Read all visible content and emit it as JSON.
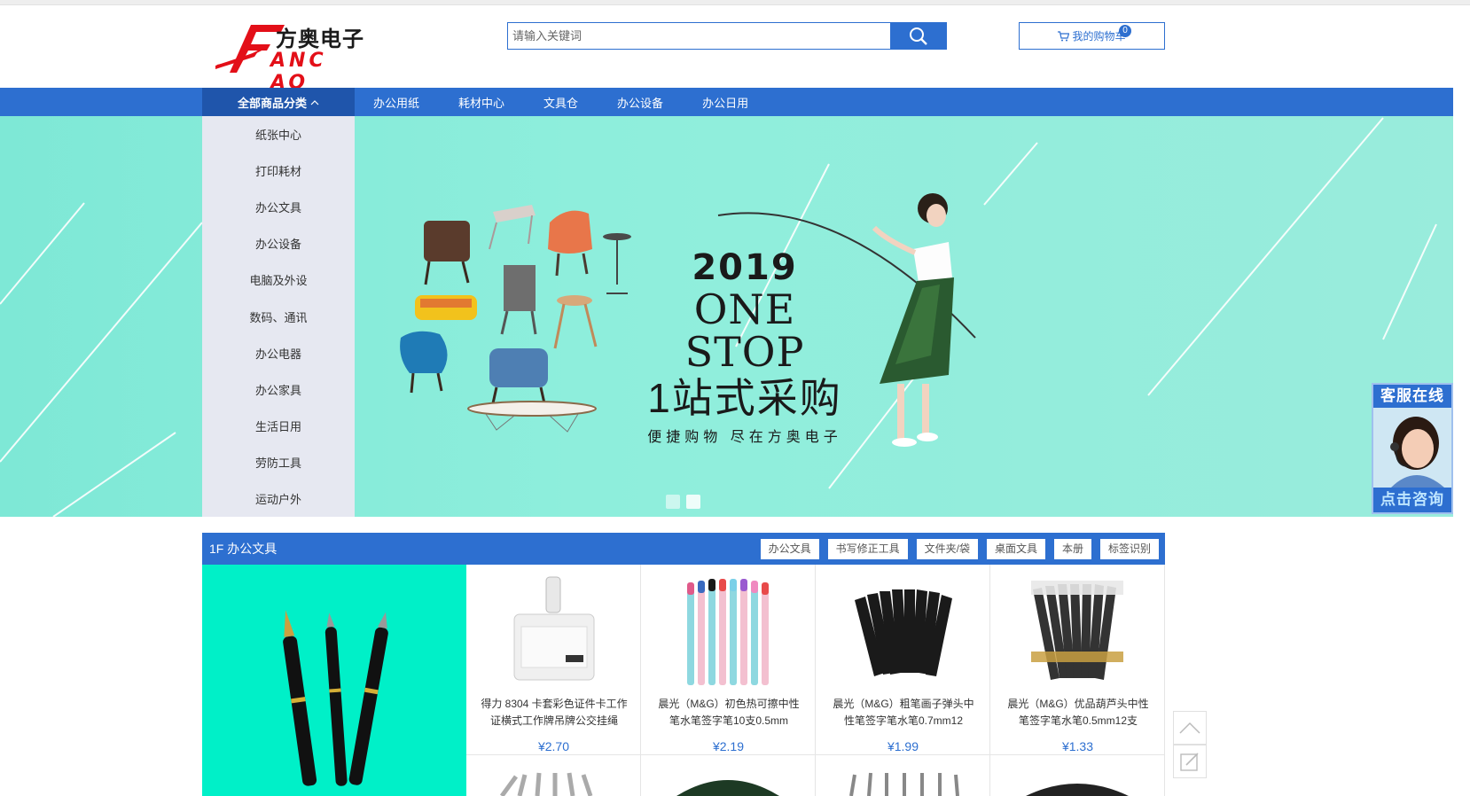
{
  "header": {
    "logo_cn": "方奥电子",
    "logo_en": "ANC AO",
    "search_placeholder": "请输入关键词",
    "cart_label": "我的购物车",
    "cart_count": "0"
  },
  "nav": {
    "all_categories": "全部商品分类",
    "items": [
      "办公用纸",
      "耗材中心",
      "文具仓",
      "办公设备",
      "办公日用"
    ]
  },
  "categories": [
    "纸张中心",
    "打印耗材",
    "办公文具",
    "办公设备",
    "电脑及外设",
    "数码、通讯",
    "办公电器",
    "办公家具",
    "生活日用",
    "劳防工具",
    "运动户外"
  ],
  "banner": {
    "year": "2019",
    "title_en": "ONE STOP",
    "title_cn": "1站式采购",
    "subtitle": "便捷购物 尽在方奥电子",
    "slide_count": 2,
    "active_slide": 1
  },
  "service": {
    "top_label": "客服在线",
    "bottom_label": "点击咨询"
  },
  "floor": {
    "title": "1F 办公文具",
    "tabs": [
      "办公文具",
      "书写修正工具",
      "文件夹/袋",
      "桌面文具",
      "本册",
      "标签识别"
    ],
    "products": [
      {
        "name": "得力 8304 卡套彩色证件卡工作证横式工作牌吊牌公交挂绳",
        "price": "¥2.70",
        "icon": "card-holder"
      },
      {
        "name": "晨光（M&G）初色热可擦中性笔水笔签字笔10支0.5mm",
        "price": "¥2.19",
        "icon": "erasable-pens"
      },
      {
        "name": "晨光（M&G）粗笔画子弹头中性笔签字笔水笔0.7mm12",
        "price": "¥1.99",
        "icon": "black-gel-pens"
      },
      {
        "name": "晨光（M&G）优品葫芦头中性笔签字笔水笔0.5mm12支",
        "price": "¥1.33",
        "icon": "gourd-gel-pens"
      }
    ]
  },
  "colors": {
    "primary": "#2d6fd0",
    "banner_bg": "#8eeedc",
    "floor_ad_bg": "#00f0c8",
    "sidebar_bg": "#e6e8f1"
  }
}
